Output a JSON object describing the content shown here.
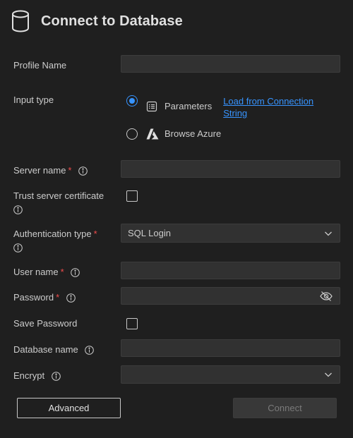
{
  "header": {
    "title": "Connect to Database",
    "icon": "database-icon"
  },
  "form": {
    "profile_name": {
      "label": "Profile Name",
      "value": "",
      "placeholder": ""
    },
    "input_type": {
      "label": "Input type",
      "options": [
        {
          "label": "Parameters",
          "selected": true,
          "icon": "parameters-icon"
        },
        {
          "label": "Browse Azure",
          "selected": false,
          "icon": "azure-icon"
        }
      ],
      "link": "Load from Connection String"
    },
    "server_name": {
      "label": "Server name",
      "required": "*",
      "value": ""
    },
    "trust_cert": {
      "label": "Trust server certificate",
      "checked": false
    },
    "auth_type": {
      "label": "Authentication type",
      "required": "*",
      "value": "SQL Login"
    },
    "user_name": {
      "label": "User name",
      "required": "*",
      "value": ""
    },
    "password": {
      "label": "Password",
      "required": "*",
      "value": ""
    },
    "save_password": {
      "label": "Save Password",
      "checked": false
    },
    "database_name": {
      "label": "Database name",
      "value": ""
    },
    "encrypt": {
      "label": "Encrypt",
      "value": ""
    }
  },
  "buttons": {
    "advanced": "Advanced",
    "connect": "Connect"
  },
  "colors": {
    "accent": "#3794ff",
    "required": "#f14c4c",
    "background": "#1f1f1f",
    "input_bg": "#313131"
  }
}
